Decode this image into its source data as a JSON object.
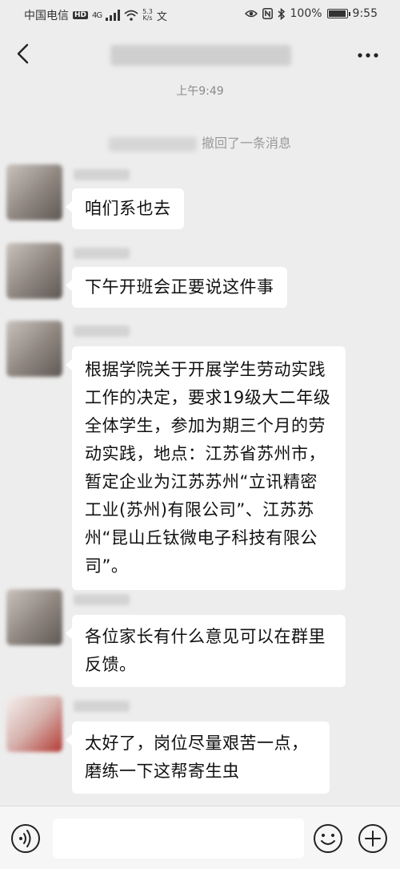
{
  "status_bar": {
    "carrier": "中国电信",
    "hd_badge": "HD",
    "signal": "4G",
    "speed_value": "5.3",
    "speed_unit": "K/s",
    "extra_icon": "文",
    "battery": "100%",
    "battery_level": 1.0,
    "time": "9:55",
    "icons": [
      "eye-icon",
      "nfc-icon",
      "bluetooth-icon",
      "battery-icon"
    ]
  },
  "header": {
    "back_icon": "chevron-left-icon",
    "more_icon": "more-dots-icon"
  },
  "chat": {
    "timestamp": "上午9:49",
    "recall_notice": "撤回了一条消息",
    "messages": [
      {
        "text": "咱们系也去"
      },
      {
        "text": "下午开班会正要说这件事"
      },
      {
        "text": "根据学院关于开展学生劳动实践工作的决定，要求19级大二年级全体学生，参加为期三个月的劳动实践，地点：江苏省苏州市，暂定企业为江苏苏州“立讯精密工业(苏州)有限公司”、江苏苏州“昆山丘钛微电子科技有限公司”。"
      },
      {
        "text": "各位家长有什么意见可以在群里反馈。"
      },
      {
        "text": "太好了，岗位尽量艰苦一点，磨练一下这帮寄生虫"
      }
    ]
  },
  "input_bar": {
    "voice_icon": "voice-icon",
    "input_value": "",
    "emoji_icon": "emoji-icon",
    "plus_icon": "plus-icon"
  },
  "colors": {
    "background": "#ededed",
    "bubble": "#ffffff",
    "meta_text": "#8a8a8a"
  }
}
